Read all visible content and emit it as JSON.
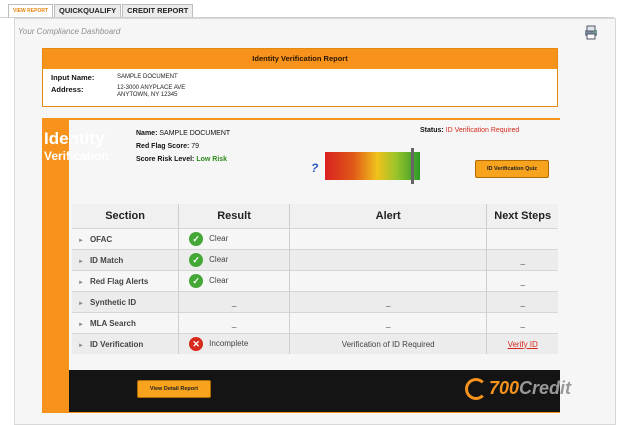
{
  "tabs": [
    "VIEW REPORT",
    "QUICKQUALIFY",
    "CREDIT REPORT"
  ],
  "dashboard_title": "Your Compliance Dashboard",
  "report": {
    "title": "Identity Verification Report",
    "input_name_label": "Input Name:",
    "input_name_value": "SAMPLE DOCUMENT",
    "address_label": "Address:",
    "address_line1": "12-3000 ANYPLACE AVE",
    "address_line2": "ANYTOWN, NY 12345"
  },
  "identity": {
    "title_word1": "Identity",
    "title_word2": "Verification",
    "name_label": "Name:",
    "name_value": "SAMPLE DOCUMENT",
    "red_flag_label": "Red Flag Score:",
    "red_flag_value": "79",
    "risk_label": "Score Risk Level:",
    "risk_value": "Low Risk",
    "status_label": "Status:",
    "status_value": "ID Verification Required",
    "help_glyph": "?",
    "gauge_level": 0.92,
    "quiz_button": "ID Verification Quiz"
  },
  "table": {
    "headers": [
      "Section",
      "Result",
      "Alert",
      "Next Steps"
    ],
    "rows": [
      {
        "section": "OFAC",
        "result": "Clear",
        "status": "ok",
        "alert": "",
        "next": ""
      },
      {
        "section": "ID Match",
        "result": "Clear",
        "status": "ok",
        "alert": "",
        "next": "_"
      },
      {
        "section": "Red Flag Alerts",
        "result": "Clear",
        "status": "ok",
        "alert": "",
        "next": "_"
      },
      {
        "section": "Synthetic ID",
        "result": "_",
        "status": "none",
        "alert": "_",
        "next": "_"
      },
      {
        "section": "MLA Search",
        "result": "_",
        "status": "none",
        "alert": "_",
        "next": "_"
      },
      {
        "section": "ID Verification",
        "result": "Incomplete",
        "status": "bad",
        "alert": "Verification of ID Required",
        "next": "Verify ID"
      }
    ]
  },
  "footer": {
    "detail_button": "View Detail Report",
    "brand_num": "700",
    "brand_word": "Credit"
  },
  "colors": {
    "accent": "#f7931d",
    "danger": "#d62a1f",
    "success": "#43a835"
  },
  "icons": [
    "print-icon",
    "help-icon",
    "check-icon",
    "x-icon",
    "expand-arrow-icon",
    "brand-logo-icon"
  ]
}
